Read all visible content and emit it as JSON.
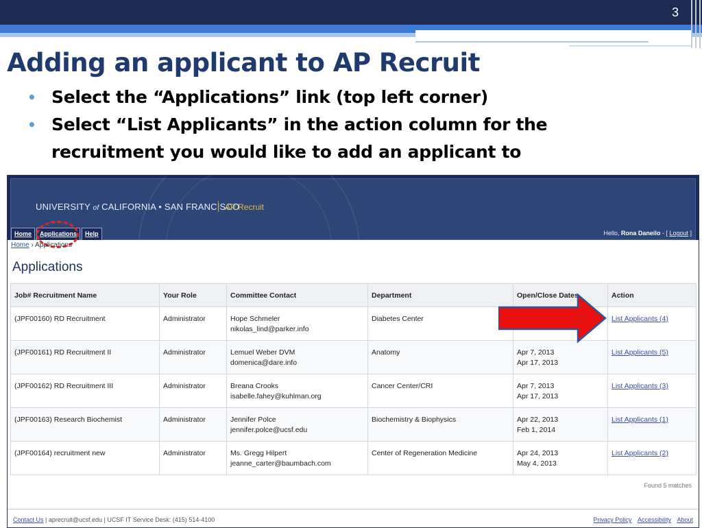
{
  "slide": {
    "number": "3",
    "title": "Adding an applicant to AP Recruit",
    "bullets": [
      "Select the “Applications” link (top left corner)",
      "Select “List Applicants” in the action column for the recruitment you would like to add an applicant to"
    ]
  },
  "app": {
    "university_pre": "UNIVERSITY",
    "university_of": "of",
    "university_post": "CALIFORNIA • SAN FRANCISCO",
    "name": "AP Recruit",
    "nav": [
      "Home",
      "Applications",
      "Help"
    ],
    "hello_prefix": "Hello,",
    "user": "Rona Daneilo",
    "logout_pre": "- [",
    "logout": "Logout",
    "logout_post": "]"
  },
  "breadcrumb": {
    "home": "Home",
    "sep": "›",
    "current": "Applications"
  },
  "page_title": "Applications",
  "table": {
    "headers": [
      "Job# Recruitment Name",
      "Your Role",
      "Committee Contact",
      "Department",
      "Open/Close Dates",
      "Action"
    ],
    "rows": [
      {
        "job": "(JPF00160) RD Recruitment",
        "role": "Administrator",
        "contact_name": "Hope Schmeler",
        "contact_email": "nikolas_lind@parker.info",
        "department": "Diabetes Center",
        "open": "",
        "close": "",
        "action": "List Applicants (4)"
      },
      {
        "job": "(JPF00161) RD Recruitment II",
        "role": "Administrator",
        "contact_name": "Lemuel Weber DVM",
        "contact_email": "domenica@dare.info",
        "department": "Anatomy",
        "open": "Apr 7, 2013",
        "close": "Apr 17, 2013",
        "action": "List Applicants (5)"
      },
      {
        "job": "(JPF00162) RD Recruitment III",
        "role": "Administrator",
        "contact_name": "Breana Crooks",
        "contact_email": "isabelle.fahey@kuhlman.org",
        "department": "Cancer Center/CRI",
        "open": "Apr 7, 2013",
        "close": "Apr 17, 2013",
        "action": "List Applicants (3)"
      },
      {
        "job": "(JPF00163) Research Biochemist",
        "role": "Administrator",
        "contact_name": "Jennifer Polce",
        "contact_email": "jennifer.polce@ucsf.edu",
        "department": "Biochemistry & Biophysics",
        "open": "Apr 22, 2013",
        "close": "Feb 1, 2014",
        "action": "List Applicants (1)"
      },
      {
        "job": "(JPF00164) recruitment new",
        "role": "Administrator",
        "contact_name": "Ms. Gregg Hilpert",
        "contact_email": "jeanne_carter@baumbach.com",
        "department": "Center of Regeneration Medicine",
        "open": "Apr 24, 2013",
        "close": "May 4, 2013",
        "action": "List Applicants (2)"
      }
    ]
  },
  "found": "Found 5 matches",
  "footer": {
    "contact": "Contact Us",
    "contact_info": "| aprecruit@ucsf.edu | UCSF IT Service Desk: (415) 514-4100",
    "links": [
      "Privacy Policy",
      "Accessibility",
      "About"
    ]
  },
  "colors": {
    "navy": "#1f2a52",
    "title": "#1f3a6d",
    "accent_gold": "#e0b84e",
    "arrow_red": "#e8110f",
    "link": "#3c4ea3"
  }
}
